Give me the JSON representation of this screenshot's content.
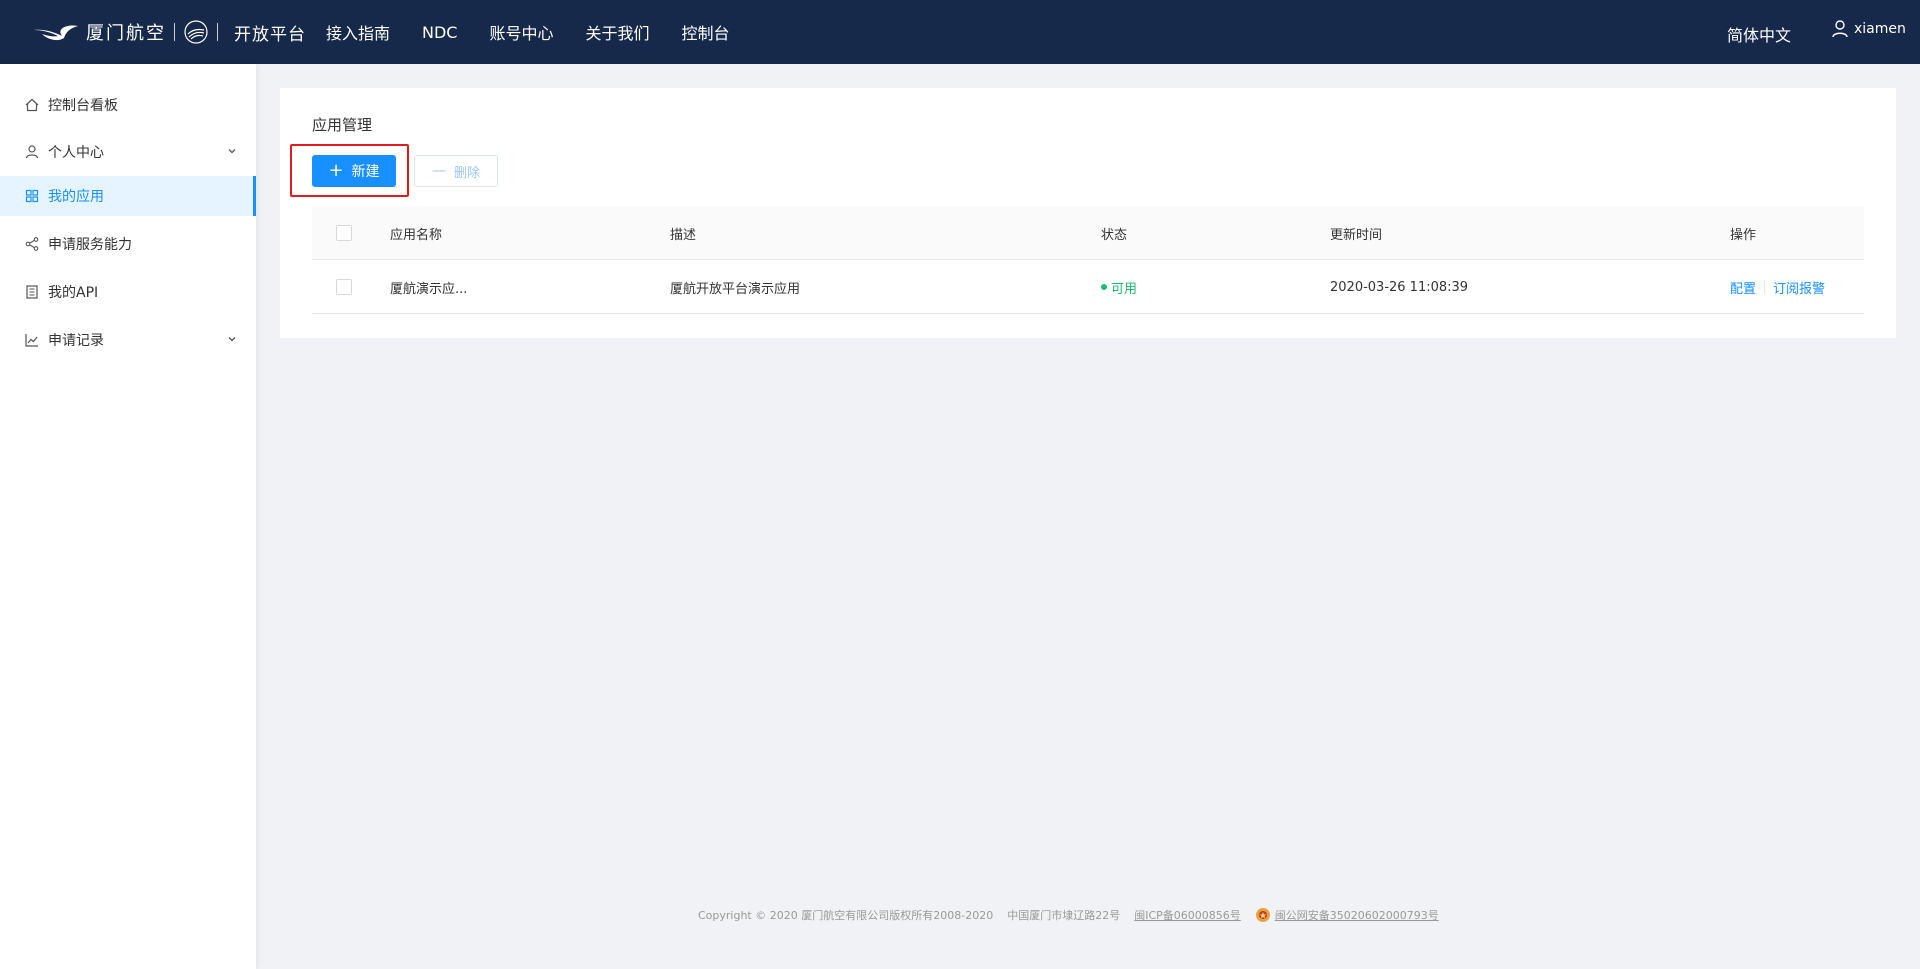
{
  "header": {
    "logo_text": "厦门航空",
    "logo_platform": "开放平台",
    "nav": [
      "接入指南",
      "NDC",
      "账号中心",
      "关于我们",
      "控制台"
    ],
    "language": "简体中文",
    "username": "xiamen"
  },
  "sidebar": {
    "items": [
      {
        "label": "控制台看板",
        "icon": "home-icon"
      },
      {
        "label": "个人中心",
        "icon": "user-icon",
        "expandable": true
      },
      {
        "label": "我的应用",
        "icon": "appstore-icon",
        "active": true
      },
      {
        "label": "申请服务能力",
        "icon": "share-icon"
      },
      {
        "label": "我的API",
        "icon": "book-icon"
      },
      {
        "label": "申请记录",
        "icon": "line-chart-icon",
        "expandable": true
      }
    ]
  },
  "main": {
    "title": "应用管理",
    "new_button": "新建",
    "delete_button": "删除",
    "table": {
      "columns": [
        "应用名称",
        "描述",
        "状态",
        "更新时间",
        "操作"
      ],
      "rows": [
        {
          "name": "厦航演示应...",
          "description": "厦航开放平台演示应用",
          "status": "可用",
          "updated": "2020-03-26 11:08:39",
          "actions": [
            "配置",
            "订阅报警"
          ]
        }
      ]
    }
  },
  "footer": {
    "copyright": "Copyright © 2020 厦门航空有限公司版权所有2008-2020",
    "address": "中国厦门市埭辽路22号",
    "icp": "闽ICP备06000856号",
    "police": "闽公网安备35020602000793号"
  },
  "colors": {
    "header_bg": "#16294a",
    "primary": "#1890ff",
    "status_available": "#19be6b",
    "highlight_border": "#e21c1c"
  }
}
